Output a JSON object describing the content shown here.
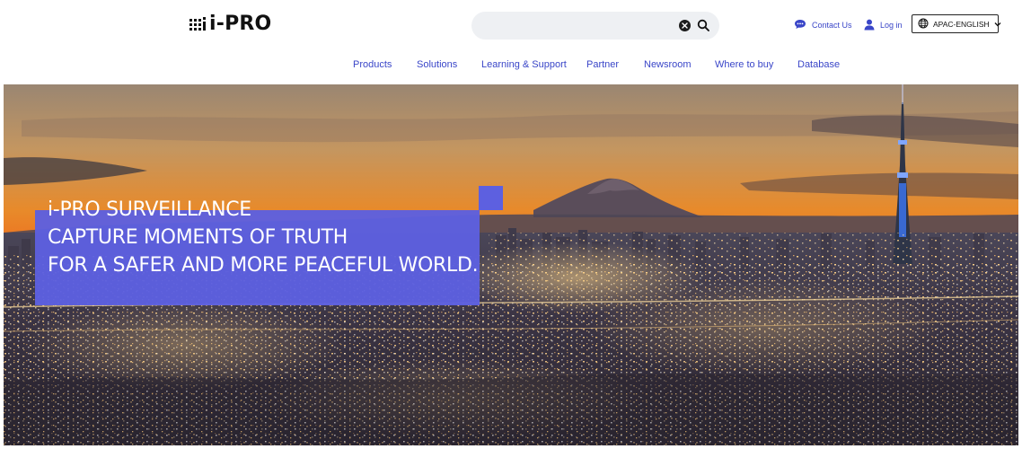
{
  "header": {
    "logo_text": "i-PRO",
    "search": {
      "value": "",
      "placeholder": ""
    },
    "contact_label": "Contact Us",
    "login_label": "Log in",
    "language_label": "APAC-ENGLISH"
  },
  "nav": {
    "items": [
      "Products",
      "Solutions",
      "Learning & Support",
      "Partner",
      "Newsroom",
      "Where to buy",
      "Database"
    ]
  },
  "hero": {
    "headline_lines": [
      "i-PRO SURVEILLANCE",
      "CAPTURE MOMENTS OF TRUTH",
      "FOR A SAFER AND MORE PEACEFUL WORLD."
    ]
  },
  "colors": {
    "brand_accent": "#5d60e0",
    "link": "#3a46c8",
    "text_dark": "#111111"
  },
  "icons": {
    "logo": "dot-grid-icon",
    "clear": "clear-circle-icon",
    "search": "search-icon",
    "contact": "chat-bubble-icon",
    "login": "user-icon",
    "language": "globe-icon",
    "dropdown": "chevron-down-icon"
  }
}
